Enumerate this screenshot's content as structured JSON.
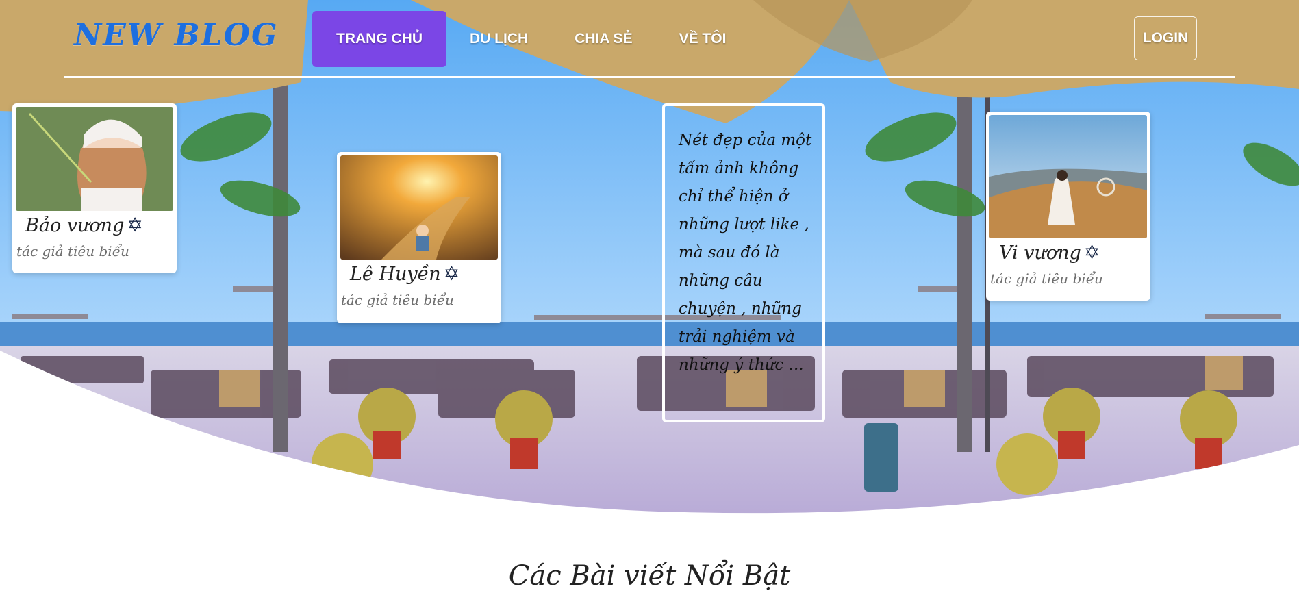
{
  "header": {
    "logo": "NEW BLOG",
    "nav": [
      {
        "label": "TRANG CHỦ",
        "active": true
      },
      {
        "label": "DU LỊCH"
      },
      {
        "label": "CHIA SẺ"
      },
      {
        "label": "VỀ TÔI"
      }
    ],
    "login_label": "LOGIN"
  },
  "authors": [
    {
      "name": "Bảo vương",
      "role": "tác giả tiêu biểu",
      "icon": "star-of-david-icon"
    },
    {
      "name": "Lê Huyền",
      "role": "tác giả tiêu biểu",
      "icon": "star-of-david-icon"
    },
    {
      "name": "Vi vương",
      "role": "tác giả tiêu biểu",
      "icon": "star-of-david-icon"
    }
  ],
  "quote": "Nét đẹp của một tấm ảnh không chỉ thể hiện ở những lượt like , mà sau đó là những câu chuyện , những trải nghiệm và những ý thức ...",
  "section_title": "Các Bài viết Nổi Bật",
  "colors": {
    "logo": "#1d6fe0",
    "nav_active": "#7b46e6",
    "sky": "#6fb4f5",
    "umbrella": "#c9a86a"
  }
}
